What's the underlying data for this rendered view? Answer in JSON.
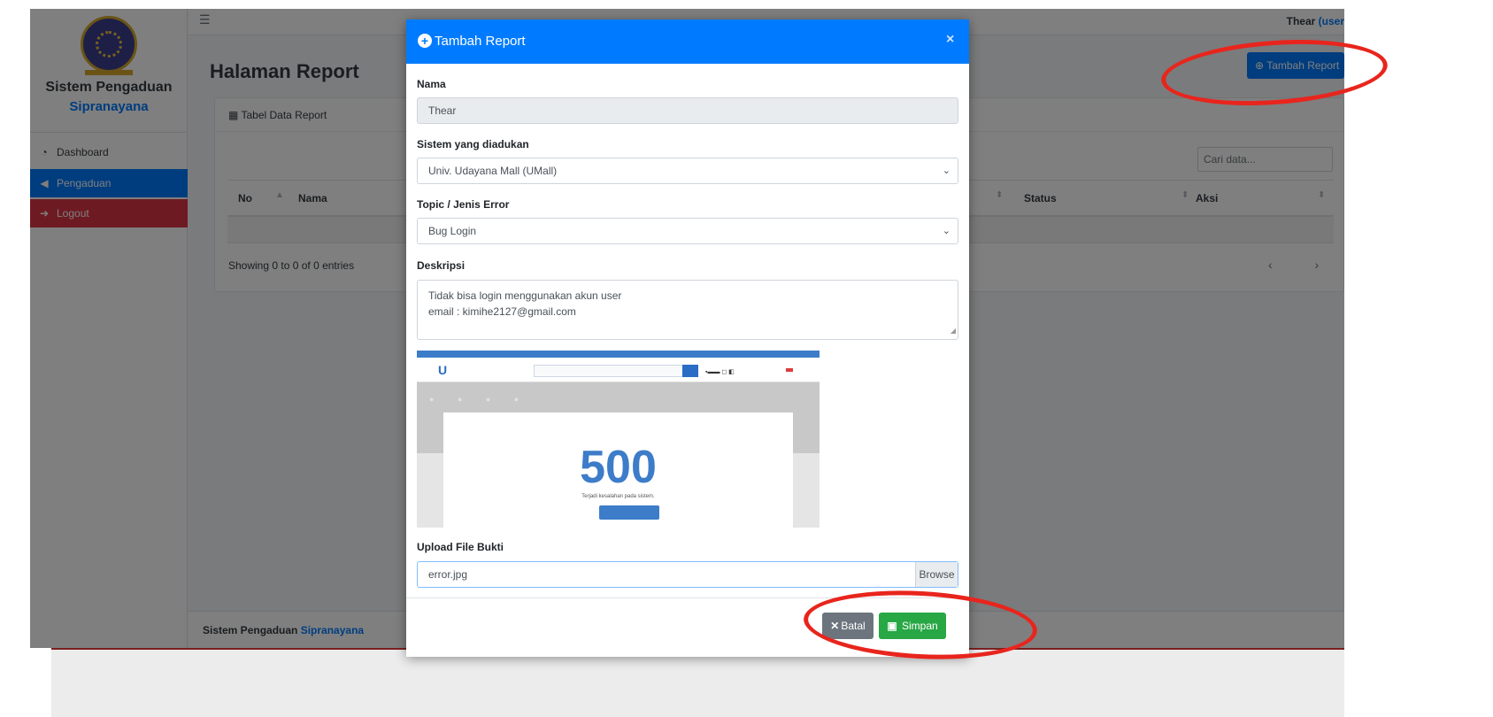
{
  "sidebar": {
    "brand_title": "Sistem Pengaduan",
    "brand_subtitle": "Sipranayana",
    "items": [
      {
        "label": "Dashboard",
        "icon": "tachometer-icon"
      },
      {
        "label": "Pengaduan",
        "icon": "megaphone-icon"
      },
      {
        "label": "Logout",
        "icon": "sign-out-icon"
      }
    ]
  },
  "topbar": {
    "user": "Thear",
    "role": "(user"
  },
  "page": {
    "title": "Halaman Report",
    "add_button": "Tambah Report"
  },
  "table_card": {
    "header": "Tabel Data Report",
    "search_placeholder": "Cari data...",
    "columns": [
      "No",
      "Nama",
      "Status",
      "Aksi"
    ],
    "showing": "Showing 0 to 0 of 0 entries",
    "pager": "‹ ›"
  },
  "footer": {
    "text": "Sistem Pengaduan",
    "accent": "Sipranayana"
  },
  "modal": {
    "title": "Tambah Report",
    "close": "×",
    "fields": {
      "nama_label": "Nama",
      "nama_value": "Thear",
      "sistem_label": "Sistem yang diadukan",
      "sistem_value": "Univ. Udayana Mall (UMall)",
      "topic_label": "Topic / Jenis Error",
      "topic_value": "Bug Login",
      "deskripsi_label": "Deskripsi",
      "deskripsi_line1": "Tidak bisa login menggunakan akun user",
      "deskripsi_line2": "email : kimihe2127@gmail.com",
      "upload_label": "Upload File Bukti",
      "upload_value": "error.jpg",
      "browse": "Browse"
    },
    "preview": {
      "error_code": "500",
      "message": "Terjadi kesalahan pada sistem.",
      "logo": "U"
    },
    "buttons": {
      "batal": "Batal",
      "simpan": "Simpan"
    }
  },
  "colors": {
    "primary": "#007bff",
    "danger": "#dc3545",
    "success": "#28a745",
    "secondary": "#6c757d",
    "annotation": "#e8251d"
  }
}
